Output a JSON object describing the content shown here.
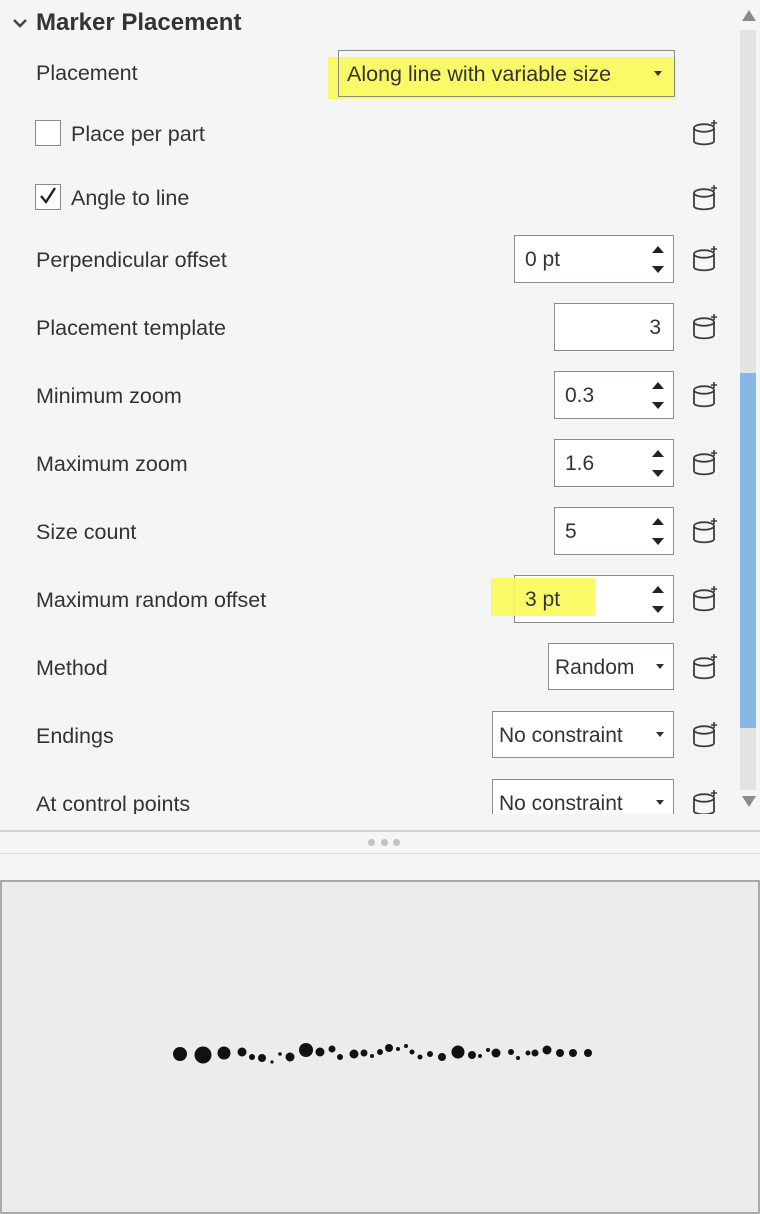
{
  "section": {
    "title": "Marker Placement"
  },
  "placement": {
    "label": "Placement",
    "value": "Along line with variable size"
  },
  "place_per_part": {
    "label": "Place per part",
    "checked": false
  },
  "angle_to_line": {
    "label": "Angle to line",
    "checked": true
  },
  "perpendicular_offset": {
    "label": "Perpendicular offset",
    "value": "0 pt"
  },
  "placement_template": {
    "label": "Placement template",
    "value": "3"
  },
  "minimum_zoom": {
    "label": "Minimum zoom",
    "value": "0.3"
  },
  "maximum_zoom": {
    "label": "Maximum zoom",
    "value": "1.6"
  },
  "size_count": {
    "label": "Size count",
    "value": "5"
  },
  "maximum_random_offset": {
    "label": "Maximum random offset",
    "value": "3 pt"
  },
  "method": {
    "label": "Method",
    "value": "Random"
  },
  "endings": {
    "label": "Endings",
    "value": "No constraint"
  },
  "at_control_points": {
    "label": "At control points",
    "value": "No constraint"
  },
  "icons": {
    "attribute_mapping": "database-icon",
    "section_toggle": "chevron-down-icon",
    "scroll_up": "scroll-up-arrow",
    "scroll_down": "scroll-down-arrow",
    "splitter": "grip-dots-icon"
  },
  "colors": {
    "highlight": "#fbfb5a",
    "scroll_thumb": "#86b8e4",
    "marker": "#111111"
  }
}
